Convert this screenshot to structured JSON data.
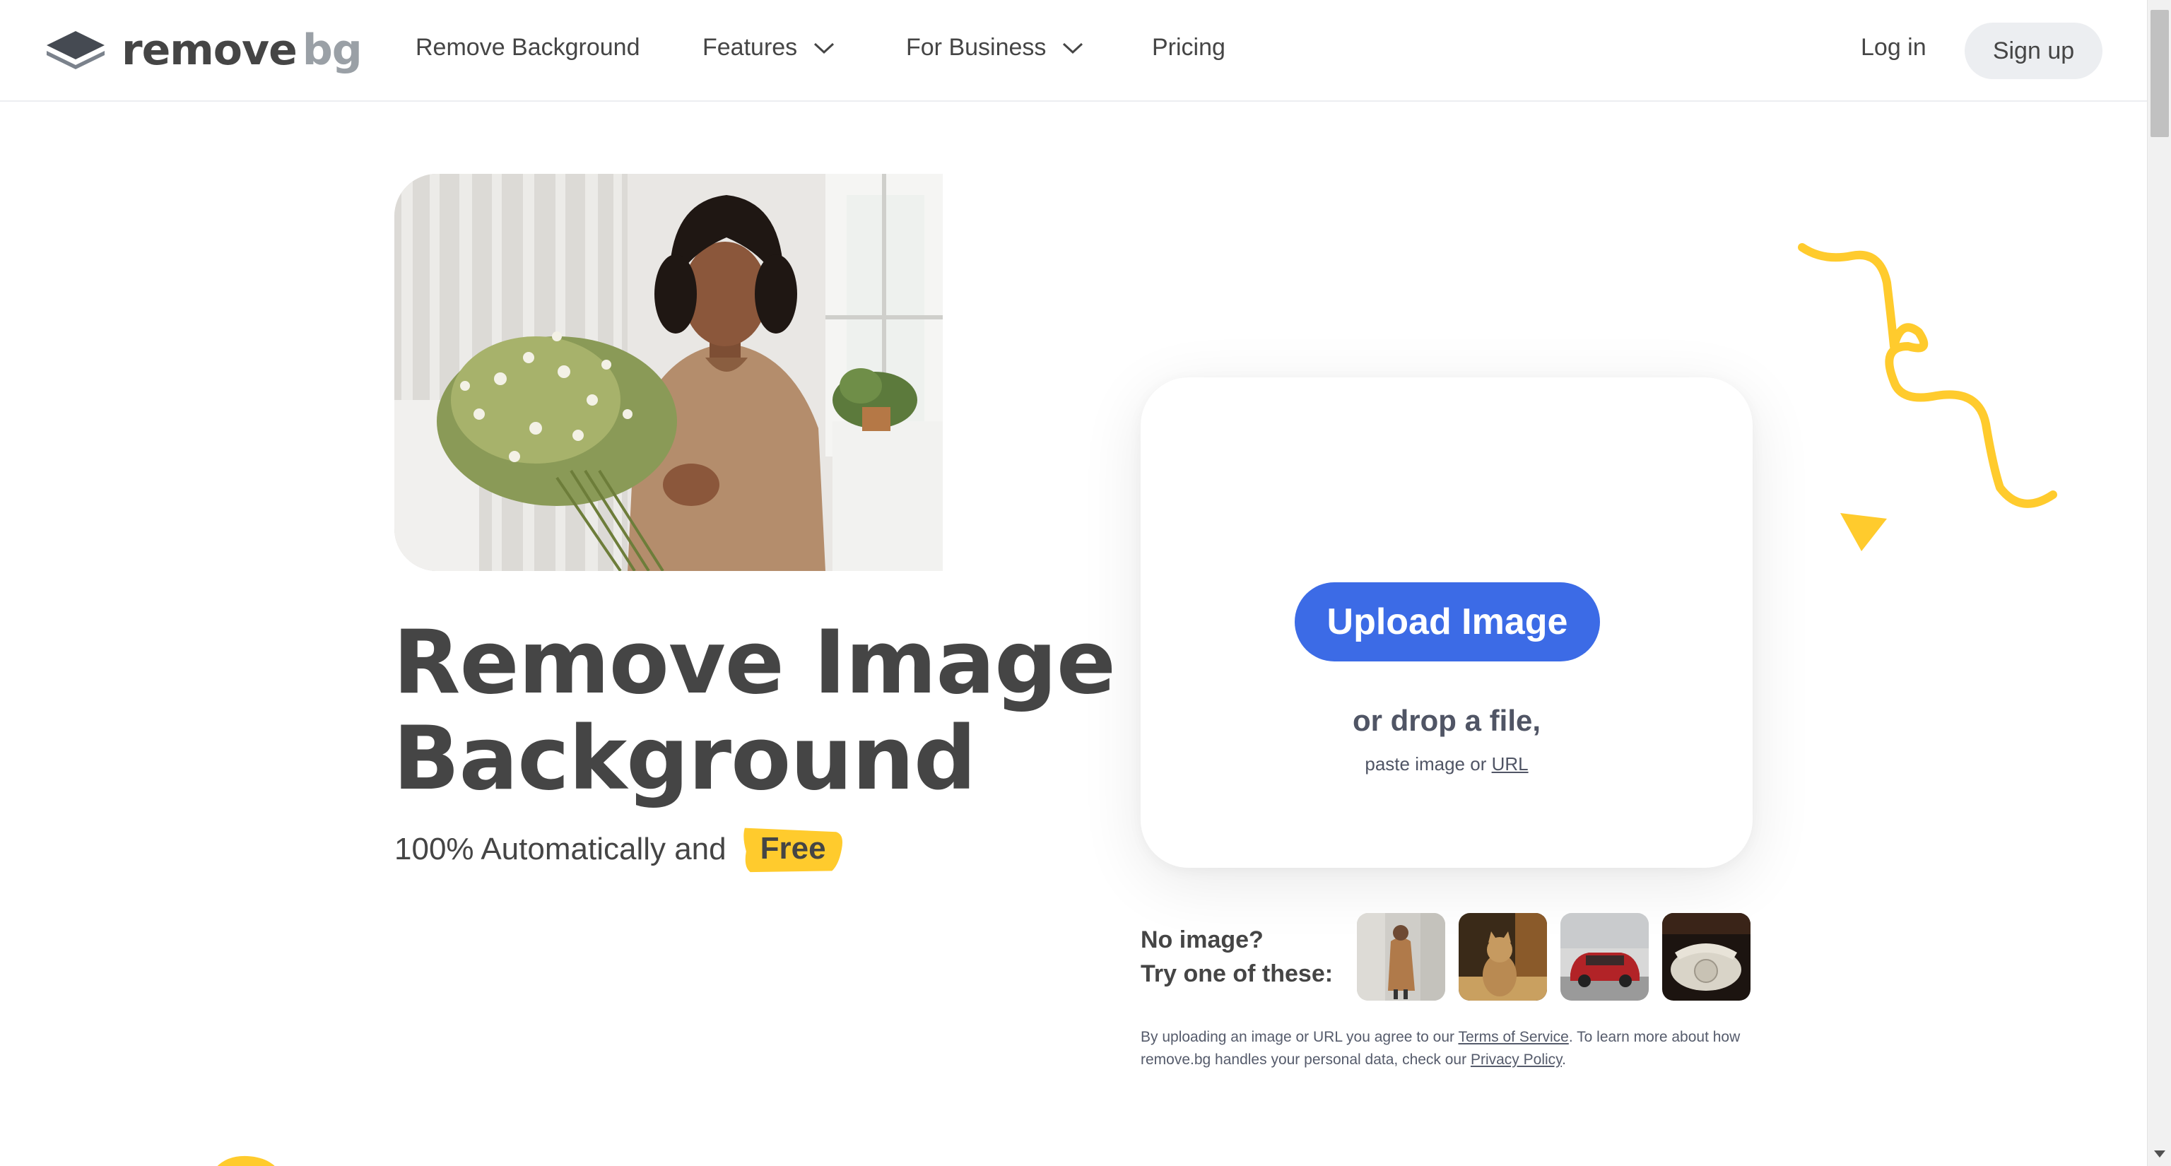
{
  "brand": {
    "name_part1": "remove",
    "name_part2": "bg",
    "accent_color": "#3c6be6",
    "highlight_color": "#ffcb2d"
  },
  "nav": {
    "items": [
      {
        "label": "Remove Background",
        "has_dropdown": false
      },
      {
        "label": "Features",
        "has_dropdown": true
      },
      {
        "label": "For Business",
        "has_dropdown": true
      },
      {
        "label": "Pricing",
        "has_dropdown": false
      }
    ],
    "login_label": "Log in",
    "signup_label": "Sign up"
  },
  "hero": {
    "title_line1": "Remove Image",
    "title_line2": "Background",
    "subtitle": "100% Automatically and",
    "badge": "Free"
  },
  "upload": {
    "button_label": "Upload Image",
    "drop_text": "or drop a file,",
    "paste_prefix": "paste image or",
    "paste_link": "URL"
  },
  "samples": {
    "prompt_line1": "No image?",
    "prompt_line2": "Try one of these:",
    "items": [
      "woman-sample-thumb",
      "cat-sample-thumb",
      "car-sample-thumb",
      "telephone-sample-thumb"
    ]
  },
  "legal": {
    "text1": "By uploading an image or URL you agree to our",
    "tos_link": "Terms of Service",
    "text2": ". To learn more about how remove.bg handles your personal data, check our",
    "privacy_link": "Privacy Policy",
    "text3": "."
  }
}
